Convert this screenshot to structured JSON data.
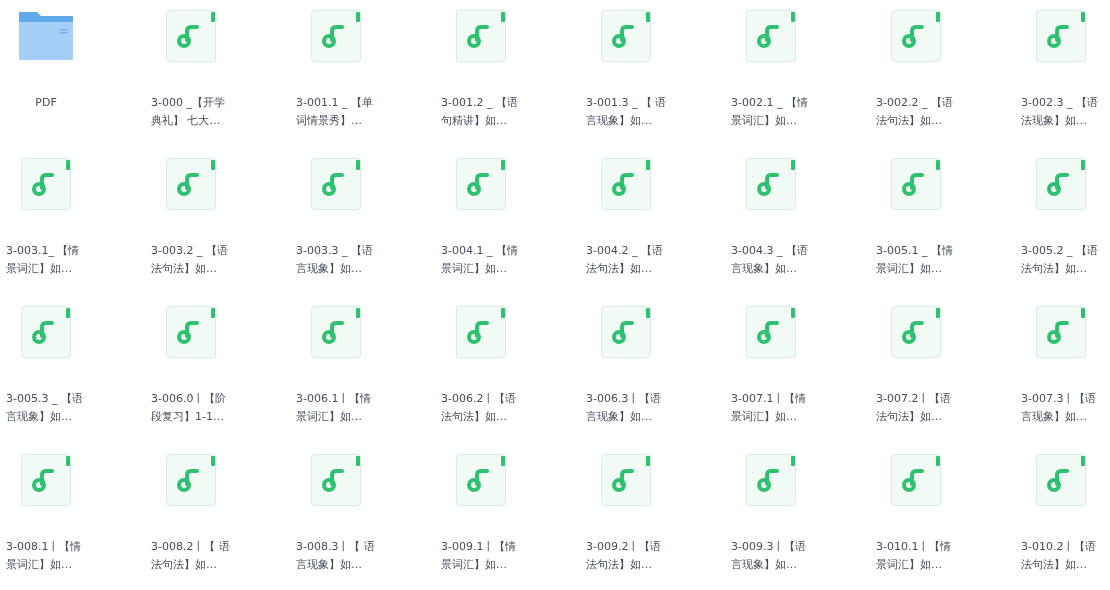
{
  "files": [
    {
      "kind": "folder",
      "lines": [
        "PDF"
      ]
    },
    {
      "kind": "audio",
      "lines": [
        "3-000 _【开学",
        "典礼】 七大…"
      ]
    },
    {
      "kind": "audio",
      "lines": [
        "3-001.1 _ 【单",
        "词情景秀】…"
      ]
    },
    {
      "kind": "audio",
      "lines": [
        "3-001.2 _ 【语",
        "句精讲】如…"
      ]
    },
    {
      "kind": "audio",
      "lines": [
        "3-001.3 _ 【 语",
        "言现象】如…"
      ]
    },
    {
      "kind": "audio",
      "lines": [
        "3-002.1 _ 【情",
        "景词汇】如…"
      ]
    },
    {
      "kind": "audio",
      "lines": [
        "3-002.2 _ 【语",
        "法句法】如…"
      ]
    },
    {
      "kind": "audio",
      "lines": [
        "3-002.3 _ 【语",
        "法现象】如…"
      ]
    },
    {
      "kind": "audio",
      "lines": [
        "3-003.1_ 【情",
        "景词汇】如…"
      ]
    },
    {
      "kind": "audio",
      "lines": [
        "3-003.2 _ 【语",
        "法句法】如…"
      ]
    },
    {
      "kind": "audio",
      "lines": [
        "3-003.3 _ 【语",
        "言现象】如…"
      ]
    },
    {
      "kind": "audio",
      "lines": [
        "3-004.1 _ 【情",
        "景词汇】如…"
      ]
    },
    {
      "kind": "audio",
      "lines": [
        "3-004.2 _ 【语",
        "法句法】如…"
      ]
    },
    {
      "kind": "audio",
      "lines": [
        "3-004.3 _ 【语",
        "言现象】如…"
      ]
    },
    {
      "kind": "audio",
      "lines": [
        "3-005.1 _ 【情",
        "景词汇】如…"
      ]
    },
    {
      "kind": "audio",
      "lines": [
        "3-005.2 _ 【语",
        "法句法】如…"
      ]
    },
    {
      "kind": "audio",
      "lines": [
        "3-005.3 _ 【语",
        "言现象】如…"
      ]
    },
    {
      "kind": "audio",
      "lines": [
        "3-006.0丨【阶",
        "段复习】1-1…"
      ]
    },
    {
      "kind": "audio",
      "lines": [
        "3-006.1丨【情",
        "景词汇】如…"
      ]
    },
    {
      "kind": "audio",
      "lines": [
        "3-006.2丨【语",
        "法句法】如…"
      ]
    },
    {
      "kind": "audio",
      "lines": [
        "3-006.3丨【语",
        "言现象】如…"
      ]
    },
    {
      "kind": "audio",
      "lines": [
        "3-007.1丨【情",
        "景词汇】如…"
      ]
    },
    {
      "kind": "audio",
      "lines": [
        "3-007.2丨【语",
        "法句法】如…"
      ]
    },
    {
      "kind": "audio",
      "lines": [
        "3-007.3丨【语",
        "言现象】如…"
      ]
    },
    {
      "kind": "audio",
      "lines": [
        "3-008.1丨【情",
        "景词汇】如…"
      ]
    },
    {
      "kind": "audio",
      "lines": [
        "3-008.2丨【 语",
        "法句法】如…"
      ]
    },
    {
      "kind": "audio",
      "lines": [
        "3-008.3丨【 语",
        "言现象】如…"
      ]
    },
    {
      "kind": "audio",
      "lines": [
        "3-009.1丨【情",
        "景词汇】如…"
      ]
    },
    {
      "kind": "audio",
      "lines": [
        "3-009.2丨【语",
        "法句法】如…"
      ]
    },
    {
      "kind": "audio",
      "lines": [
        "3-009.3丨【语",
        "言现象】如…"
      ]
    },
    {
      "kind": "audio",
      "lines": [
        "3-010.1丨【情",
        "景词汇】如…"
      ]
    },
    {
      "kind": "audio",
      "lines": [
        "3-010.2丨【语",
        "法句法】如…"
      ]
    }
  ]
}
